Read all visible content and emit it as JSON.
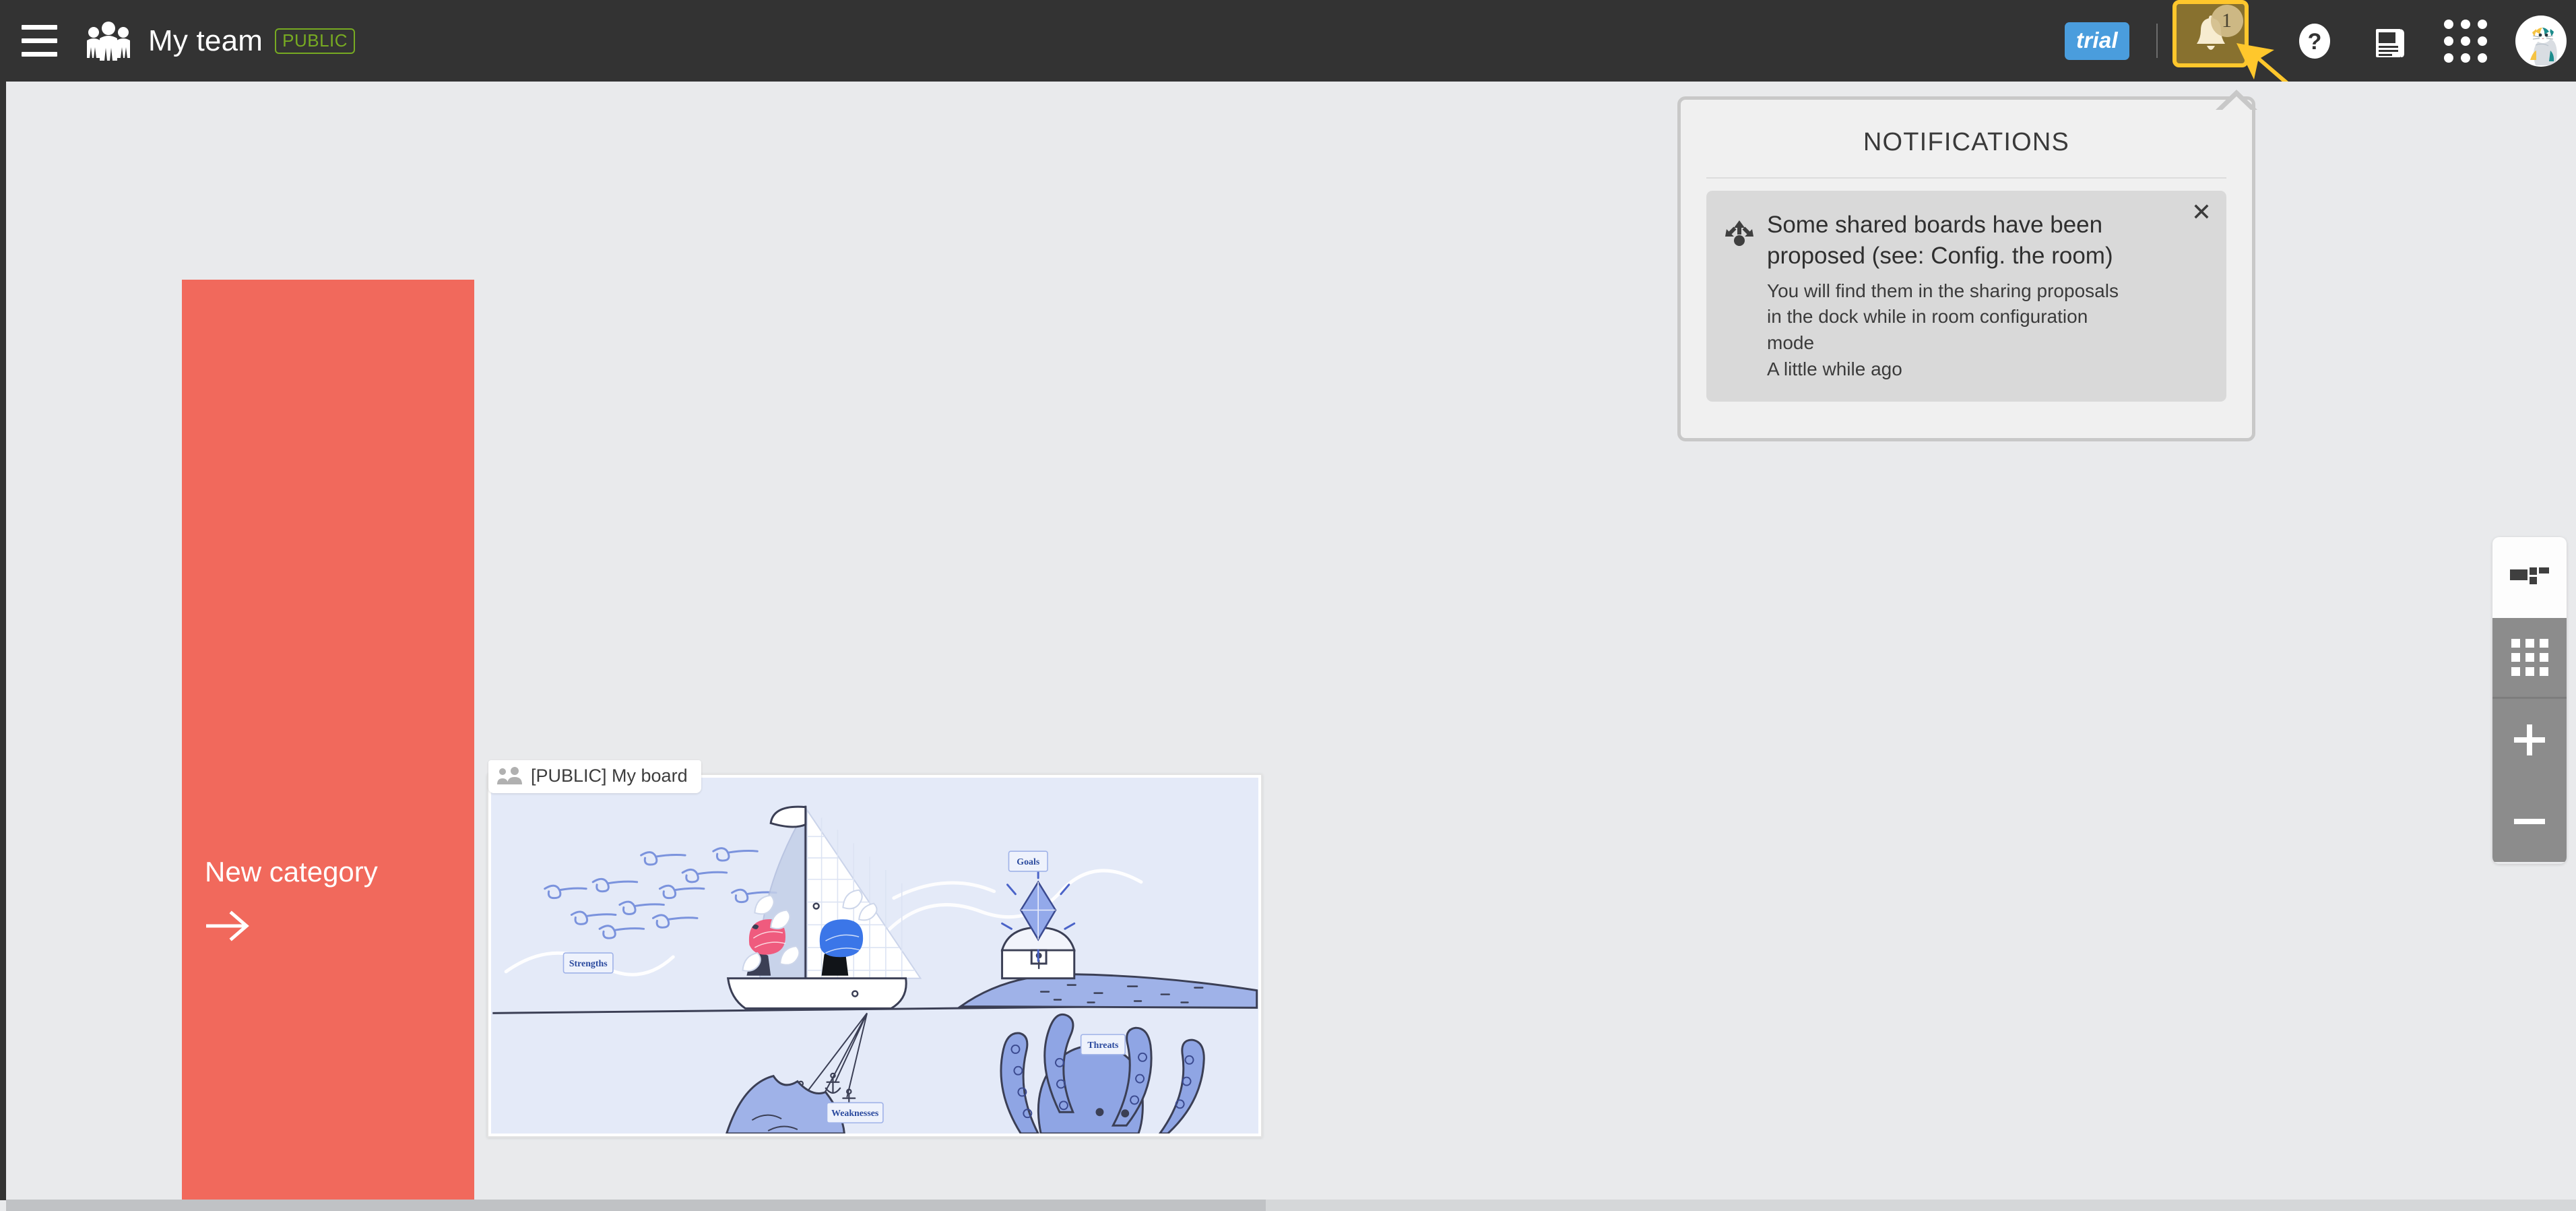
{
  "header": {
    "menu_icon": "hamburger-icon",
    "team_icon": "people-group-icon",
    "team_title": "My team",
    "visibility_badge": "PUBLIC",
    "trial_label": "trial",
    "notifications_icon": "bell-icon",
    "notifications_count": "1",
    "help_icon": "question-mark-icon",
    "news_icon": "news-document-icon",
    "apps_icon": "apps-grid-icon",
    "avatar_icon": "cat-avatar",
    "bg_color": "#333333",
    "highlight_color": "#FFC72C",
    "trial_color": "#4a9ddd",
    "visibility_color": "#77aa22"
  },
  "notifications_panel": {
    "title": "NOTIFICATIONS",
    "items": [
      {
        "icon": "share-distribute-icon",
        "title": "Some shared boards have been proposed (see: Config. the room)",
        "description": "You will find them in the sharing proposals in the dock while in room configuration mode",
        "time": "A little while ago",
        "close_icon": "close-icon",
        "close_label": "✕"
      }
    ]
  },
  "canvas": {
    "new_category": {
      "label": "New category",
      "arrow_icon": "arrow-right-icon",
      "color": "#f1695c"
    },
    "boards": [
      {
        "badge_icon": "people-group-icon",
        "name": "[PUBLIC] My board",
        "thumbnail_type": "sailboat-swot-illustration",
        "thumbnail_bg": "#e4eaf8",
        "sticky_labels": [
          "Strengths",
          "Goals",
          "Weaknesses",
          "Threats"
        ]
      }
    ]
  },
  "right_toolbar": {
    "items": [
      {
        "icon": "layout-mosaic-icon",
        "name": "layout-view"
      },
      {
        "icon": "grid-view-icon",
        "name": "grid-view"
      },
      {
        "icon": "plus-icon",
        "name": "zoom-in"
      },
      {
        "icon": "minus-icon",
        "name": "zoom-out"
      }
    ]
  },
  "scrollbar": {
    "orientation": "horizontal"
  },
  "pointer": {
    "icon": "yellow-arrow-pointer",
    "color": "#FFC72C"
  }
}
